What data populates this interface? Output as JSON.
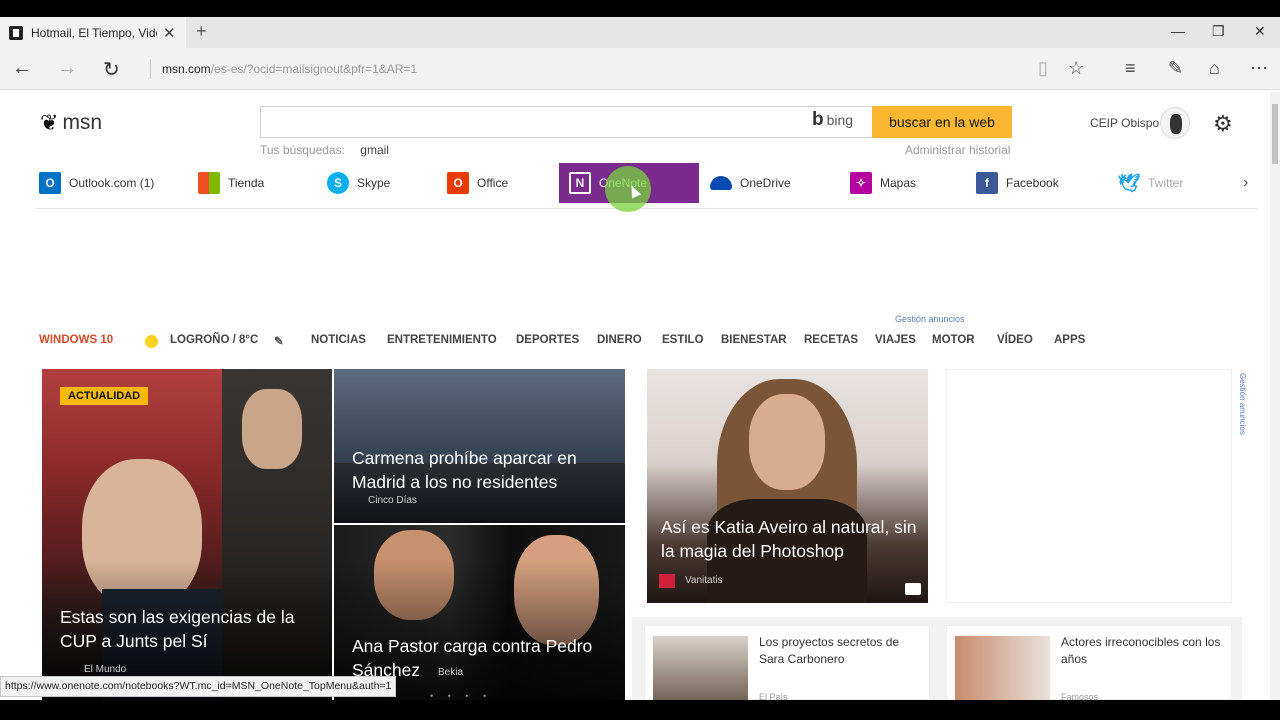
{
  "browser": {
    "tab_title": "Hotmail, El Tiempo, Vide",
    "tab_close": "✕",
    "new_tab": "+",
    "url_host": "msn.com",
    "url_path": "/es-es/?ocid=mailsignout&pfr=1&AR=1",
    "status_url": "https://www.onenote.com/notebooks?WT.mc_id=MSN_OneNote_TopMenu&auth=1"
  },
  "header": {
    "logo_text": "msn",
    "bing_label": "bing",
    "search_button": "buscar en la web",
    "recent_label": "Tus búsquedas:",
    "recent_query": "gmail",
    "history_link": "Administrar historial",
    "user_name": "CEIP Obispo"
  },
  "apps": [
    {
      "label": "Outlook.com (1)",
      "color": "#0072c6",
      "glyph": "O"
    },
    {
      "label": "Tienda",
      "color": "#f25022",
      "glyph": ""
    },
    {
      "label": "Skype",
      "color": "#00aff0",
      "glyph": "S"
    },
    {
      "label": "Office",
      "color": "#eb3c00",
      "glyph": "O"
    },
    {
      "label": "OneNote",
      "color": "#7a2c8e",
      "glyph": "N"
    },
    {
      "label": "OneDrive",
      "color": "#094ab2",
      "glyph": ""
    },
    {
      "label": "Mapas",
      "color": "#b4009e",
      "glyph": ""
    },
    {
      "label": "Facebook",
      "color": "#3b5998",
      "glyph": "f"
    },
    {
      "label": "Twitter",
      "color": "#1da1f2",
      "glyph": ""
    }
  ],
  "ad_note": "Gestión anuncios",
  "nav": {
    "windows": "WINDOWS 10",
    "weather": "LOGROÑO / 8°C",
    "items": [
      "NOTICIAS",
      "ENTRETENIMIENTO",
      "DEPORTES",
      "DINERO",
      "ESTILO",
      "BIENESTAR",
      "RECETAS",
      "VIAJES",
      "MOTOR",
      "VÍDEO",
      "APPS"
    ]
  },
  "tiles": {
    "main": {
      "badge": "ACTUALIDAD",
      "title": "Estas son las exigencias de la CUP a Junts pel Sí",
      "source": "El Mundo"
    },
    "t2": {
      "title": "Carmena prohíbe aparcar en Madrid a los no residentes",
      "source": "Cinco Días"
    },
    "t3": {
      "title": "Ana Pastor carga contra Pedro Sánchez",
      "source": "Bekia"
    },
    "t4": {
      "title": "Así es Katia Aveiro al natural, sin la magia del Photoshop",
      "source": "Vanitatis"
    },
    "mini1": {
      "title": "Los proyectos secretos de Sara Carbonero",
      "source": "El País"
    },
    "mini2": {
      "title": "Actores irreconocibles con los años",
      "source": "Famosos"
    }
  },
  "side_ad": "Gestión anuncios"
}
